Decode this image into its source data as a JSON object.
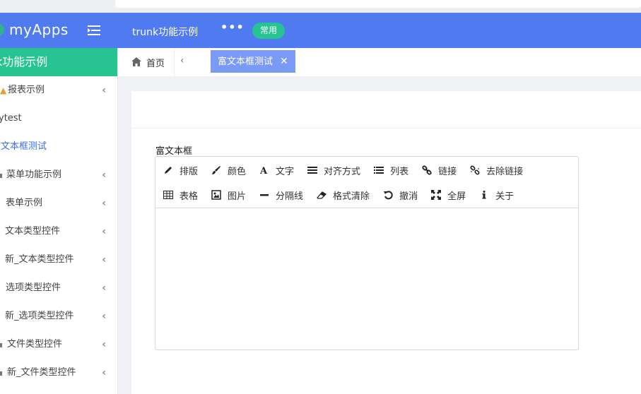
{
  "header": {
    "brand": "myApps",
    "title": "trunk功能示例",
    "more": "•••",
    "badge": "常用"
  },
  "sidebar": {
    "heading": "k功能示例",
    "items": [
      {
        "label": "报表示例",
        "has_chevron": true
      },
      {
        "label": "ytest",
        "has_chevron": false
      },
      {
        "label": "文本框测试",
        "has_chevron": false,
        "active": true
      },
      {
        "label": "菜单功能示例",
        "has_chevron": true
      },
      {
        "label": "表单示例",
        "has_chevron": true
      },
      {
        "label": "文本类型控件",
        "has_chevron": true
      },
      {
        "label": "新_文本类型控件",
        "has_chevron": true
      },
      {
        "label": "选项类型控件",
        "has_chevron": true
      },
      {
        "label": "新_选项类型控件",
        "has_chevron": true
      },
      {
        "label": "文件类型控件",
        "has_chevron": true
      },
      {
        "label": "新_文件类型控件",
        "has_chevron": true
      }
    ],
    "chevron": "‹"
  },
  "tabs": {
    "home": "首页",
    "prev": "‹",
    "active": "富文本框测试",
    "close": "✕"
  },
  "form": {
    "field_label": "富文本框"
  },
  "editor": {
    "toolbar_row1": [
      {
        "label": "排版",
        "icon": "pencil-icon"
      },
      {
        "label": "颜色",
        "icon": "brush-icon"
      },
      {
        "label": "文字",
        "icon": "font-icon"
      },
      {
        "label": "对齐方式",
        "icon": "align-icon"
      },
      {
        "label": "列表",
        "icon": "list-icon"
      },
      {
        "label": "链接",
        "icon": "link-icon"
      },
      {
        "label": "去除链接",
        "icon": "unlink-icon"
      }
    ],
    "toolbar_row2": [
      {
        "label": "表格",
        "icon": "table-icon"
      },
      {
        "label": "图片",
        "icon": "image-icon"
      },
      {
        "label": "分隔线",
        "icon": "minus-icon"
      },
      {
        "label": "格式清除",
        "icon": "eraser-icon"
      },
      {
        "label": "撤消",
        "icon": "undo-icon"
      },
      {
        "label": "全屏",
        "icon": "fullscreen-icon"
      },
      {
        "label": "关于",
        "icon": "info-icon"
      }
    ],
    "content": ""
  },
  "colors": {
    "header_bg": "#4f7af0",
    "accent_green": "#27c391",
    "active_tab": "#7a9af5",
    "active_link": "#3b6fd8"
  }
}
